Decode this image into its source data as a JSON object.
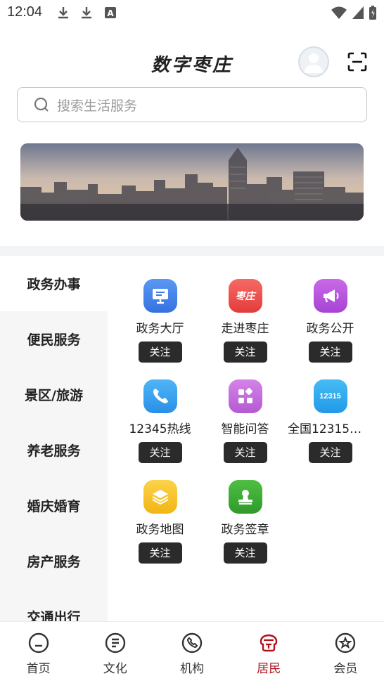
{
  "status_bar": {
    "time": "12:04",
    "icons": [
      "download-icon",
      "download-icon",
      "a-icon",
      "wifi-icon",
      "signal-icon",
      "battery-icon"
    ]
  },
  "header": {
    "title": "数字枣庄"
  },
  "search": {
    "placeholder": "搜索生活服务"
  },
  "sidebar": {
    "items": [
      {
        "label": "政务办事",
        "active": true
      },
      {
        "label": "便民服务",
        "active": false
      },
      {
        "label": "景区/旅游",
        "active": false
      },
      {
        "label": "养老服务",
        "active": false
      },
      {
        "label": "婚庆婚育",
        "active": false
      },
      {
        "label": "房产服务",
        "active": false
      },
      {
        "label": "交通出行",
        "active": false
      }
    ]
  },
  "services": [
    {
      "label": "政务大厅",
      "icon": "monitor-icon",
      "color": "#3b7be8",
      "follow": "关注"
    },
    {
      "label": "走进枣庄",
      "icon": "zaozhuang-icon",
      "icon_text": "枣庄",
      "color": "#ef4f4f",
      "follow": "关注"
    },
    {
      "label": "政务公开",
      "icon": "megaphone-icon",
      "color": "#b24ed9",
      "follow": "关注"
    },
    {
      "label": "12345热线",
      "icon": "phone-icon",
      "color": "#2f9ef0",
      "follow": "关注"
    },
    {
      "label": "智能问答",
      "icon": "apps-icon",
      "color": "#c06ad8",
      "follow": "关注"
    },
    {
      "label": "全国12315平...",
      "icon": "12315-icon",
      "icon_text": "12315",
      "color": "#2aa7ee",
      "follow": "关注"
    },
    {
      "label": "政务地图",
      "icon": "layers-icon",
      "color": "#f6c42a",
      "follow": "关注"
    },
    {
      "label": "政务签章",
      "icon": "stamp-icon",
      "color": "#3aa833",
      "follow": "关注"
    }
  ],
  "bottom_nav": {
    "items": [
      {
        "label": "首页",
        "icon": "home-icon",
        "active": false
      },
      {
        "label": "文化",
        "icon": "culture-icon",
        "active": false
      },
      {
        "label": "机构",
        "icon": "phone-circle-icon",
        "active": false
      },
      {
        "label": "居民",
        "icon": "resident-icon",
        "active": true
      },
      {
        "label": "会员",
        "icon": "member-icon",
        "active": false
      }
    ]
  },
  "colors": {
    "accent": "#b3121b",
    "follow_button": "#2b2b2b",
    "sidebar_bg": "#f6f6f6"
  }
}
